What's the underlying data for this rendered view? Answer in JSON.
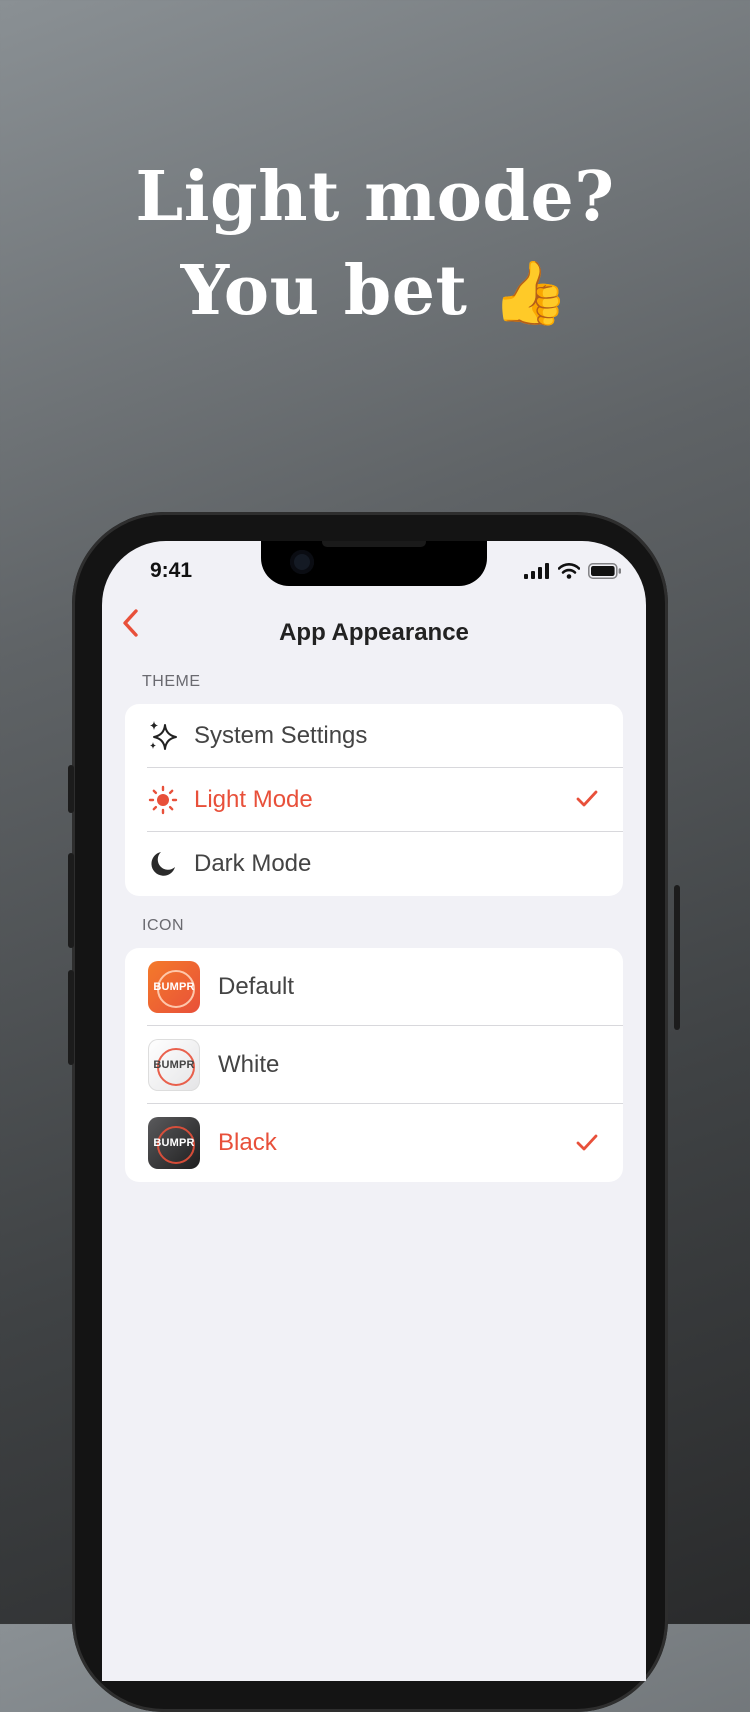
{
  "headline": {
    "line1": "Light mode?",
    "line2": "You bet",
    "emoji": "👍"
  },
  "status": {
    "time": "9:41"
  },
  "nav": {
    "title": "App Appearance",
    "back_icon": "chevron-left-icon"
  },
  "theme": {
    "section_label": "THEME",
    "items": [
      {
        "label": "System Settings",
        "icon": "sparkles-icon",
        "selected": false
      },
      {
        "label": "Light Mode",
        "icon": "sun-icon",
        "selected": true
      },
      {
        "label": "Dark Mode",
        "icon": "moon-icon",
        "selected": false
      }
    ]
  },
  "icon": {
    "section_label": "ICON",
    "items": [
      {
        "label": "Default",
        "badge": "BUMPR",
        "selected": false
      },
      {
        "label": "White",
        "badge": "BUMPR",
        "selected": false
      },
      {
        "label": "Black",
        "badge": "BUMPR",
        "selected": true
      }
    ]
  },
  "colors": {
    "accent": "#e8503a",
    "background": "#f1f1f6",
    "card": "#ffffff"
  }
}
